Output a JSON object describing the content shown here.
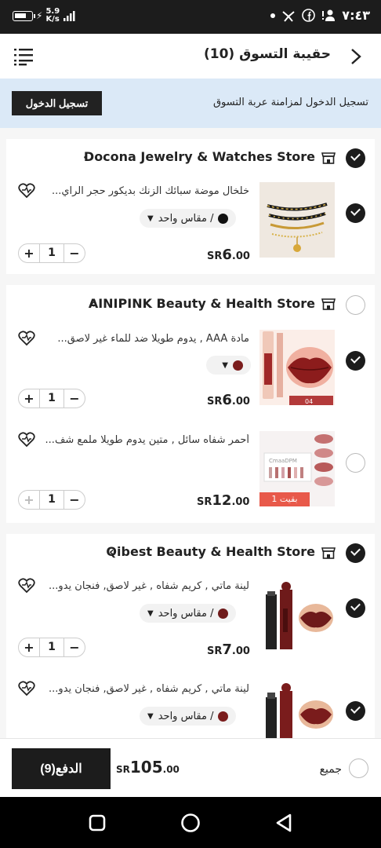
{
  "status_bar": {
    "net_speed": "5.9",
    "net_unit": "K/s",
    "time": "٧:٤٣"
  },
  "header": {
    "title": "حقيبة التسوق (10)",
    "menu_icon": "list-menu-icon",
    "back_icon": "chevron-right-icon"
  },
  "login_banner": {
    "text": "تسجيل الدخول لمزامنة عربة التسوق",
    "button": "تسجيل الدخول"
  },
  "stores": [
    {
      "name": "Docona Jewelry & Watches Store",
      "checked": true,
      "items": [
        {
          "name": "خلخال موضة سبائك الزنك بديكور حجر الراي...",
          "checked": true,
          "variant": "/ مقاس واحد",
          "variant_color": "#111111",
          "currency": "SR",
          "price_int": "6",
          "price_dec": ".00",
          "qty": "1"
        }
      ]
    },
    {
      "name": "AINIPINK Beauty & Health Store",
      "checked": false,
      "items": [
        {
          "name": "مادة AAA , يدوم طويلا ضد للماء غير لاصق...",
          "checked": true,
          "variant": "",
          "variant_color": "#7a1c1c",
          "image_caption": "04",
          "currency": "SR",
          "price_int": "6",
          "price_dec": ".00",
          "qty": "1"
        },
        {
          "name": "أحمر شفاه سائل , متين يدوم طويلا ملمع شف...",
          "checked": false,
          "image_brand": "CmaaDPM",
          "stock_badge": "بقيت 1",
          "currency": "SR",
          "price_int": "12",
          "price_dec": ".00",
          "qty": "1"
        }
      ]
    },
    {
      "name": "Qibest Beauty & Health Store",
      "checked": true,
      "items": [
        {
          "name": "لينة ماتي , كريم شفاه , غير لاصق, فنجان يدو...",
          "checked": true,
          "variant": "/ مقاس واحد",
          "variant_color": "#6e1a1a",
          "currency": "SR",
          "price_int": "7",
          "price_dec": ".00",
          "qty": "1"
        },
        {
          "name": "لينة ماتي , كريم شفاه , غير لاصق, فنجان يدو...",
          "checked": true,
          "variant": "/ مقاس واحد",
          "variant_color": "#7a1c1c"
        }
      ]
    }
  ],
  "bottom_bar": {
    "select_all": "جميع",
    "currency": "SR",
    "total_int": "105",
    "total_dec": ".00",
    "pay_button": "الدفع(9)"
  },
  "nav_bar": {
    "icons": [
      "recent-apps-icon",
      "home-icon",
      "back-icon"
    ]
  }
}
